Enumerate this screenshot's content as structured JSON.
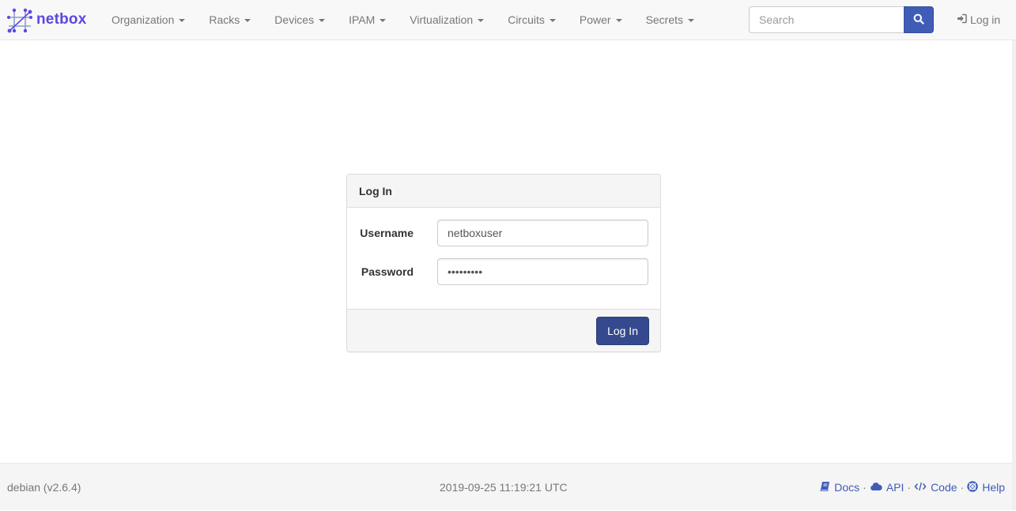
{
  "brand": {
    "name": "netbox",
    "color": "#5b47e0"
  },
  "nav": {
    "items": [
      {
        "label": "Organization"
      },
      {
        "label": "Racks"
      },
      {
        "label": "Devices"
      },
      {
        "label": "IPAM"
      },
      {
        "label": "Virtualization"
      },
      {
        "label": "Circuits"
      },
      {
        "label": "Power"
      },
      {
        "label": "Secrets"
      }
    ],
    "search_placeholder": "Search",
    "search_icon": "search-icon",
    "login_label": "Log in",
    "login_icon": "sign-in-icon"
  },
  "login_panel": {
    "title": "Log In",
    "username_label": "Username",
    "username_value": "netboxuser",
    "password_label": "Password",
    "password_value": "netboxpwd",
    "submit_label": "Log In"
  },
  "footer": {
    "hostname": "debian (v2.6.4)",
    "timestamp": "2019-09-25 11:19:21 UTC",
    "separator": "·",
    "links": [
      {
        "label": "Docs",
        "icon": "book-icon"
      },
      {
        "label": "API",
        "icon": "cloud-icon"
      },
      {
        "label": "Code",
        "icon": "code-icon"
      },
      {
        "label": "Help",
        "icon": "life-ring-icon"
      }
    ]
  },
  "colors": {
    "accent": "#3f5cb6",
    "button": "#354a8e"
  }
}
